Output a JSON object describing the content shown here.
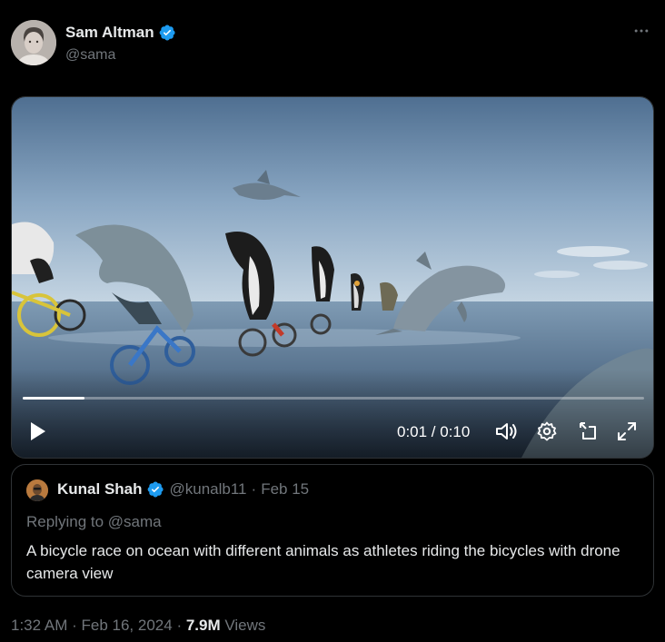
{
  "author": {
    "name": "Sam Altman",
    "handle": "@sama",
    "verified": true
  },
  "video": {
    "current_time": "0:01",
    "duration": "0:10",
    "time_display": "0:01 / 0:10",
    "progress": 0.1,
    "state": "paused"
  },
  "quote": {
    "name": "Kunal Shah",
    "handle": "@kunalb11",
    "date": "Feb 15",
    "replying_to": "Replying to @sama",
    "text": "A bicycle race on ocean with different animals as athletes riding the bicycles with drone camera view"
  },
  "meta": {
    "time": "1:32 AM",
    "date": "Feb 16, 2024",
    "views_count": "7.9M",
    "views_label": "Views"
  },
  "icons": {
    "verified": "verified-badge-icon",
    "more": "more-options-icon",
    "play": "play-icon",
    "volume": "volume-icon",
    "settings": "gear-icon",
    "pip": "picture-in-picture-icon",
    "fullscreen": "fullscreen-icon"
  },
  "colors": {
    "background": "#000000",
    "text": "#e7e9ea",
    "muted": "#71767b",
    "border": "#2f3336",
    "verified": "#1d9bf0"
  }
}
